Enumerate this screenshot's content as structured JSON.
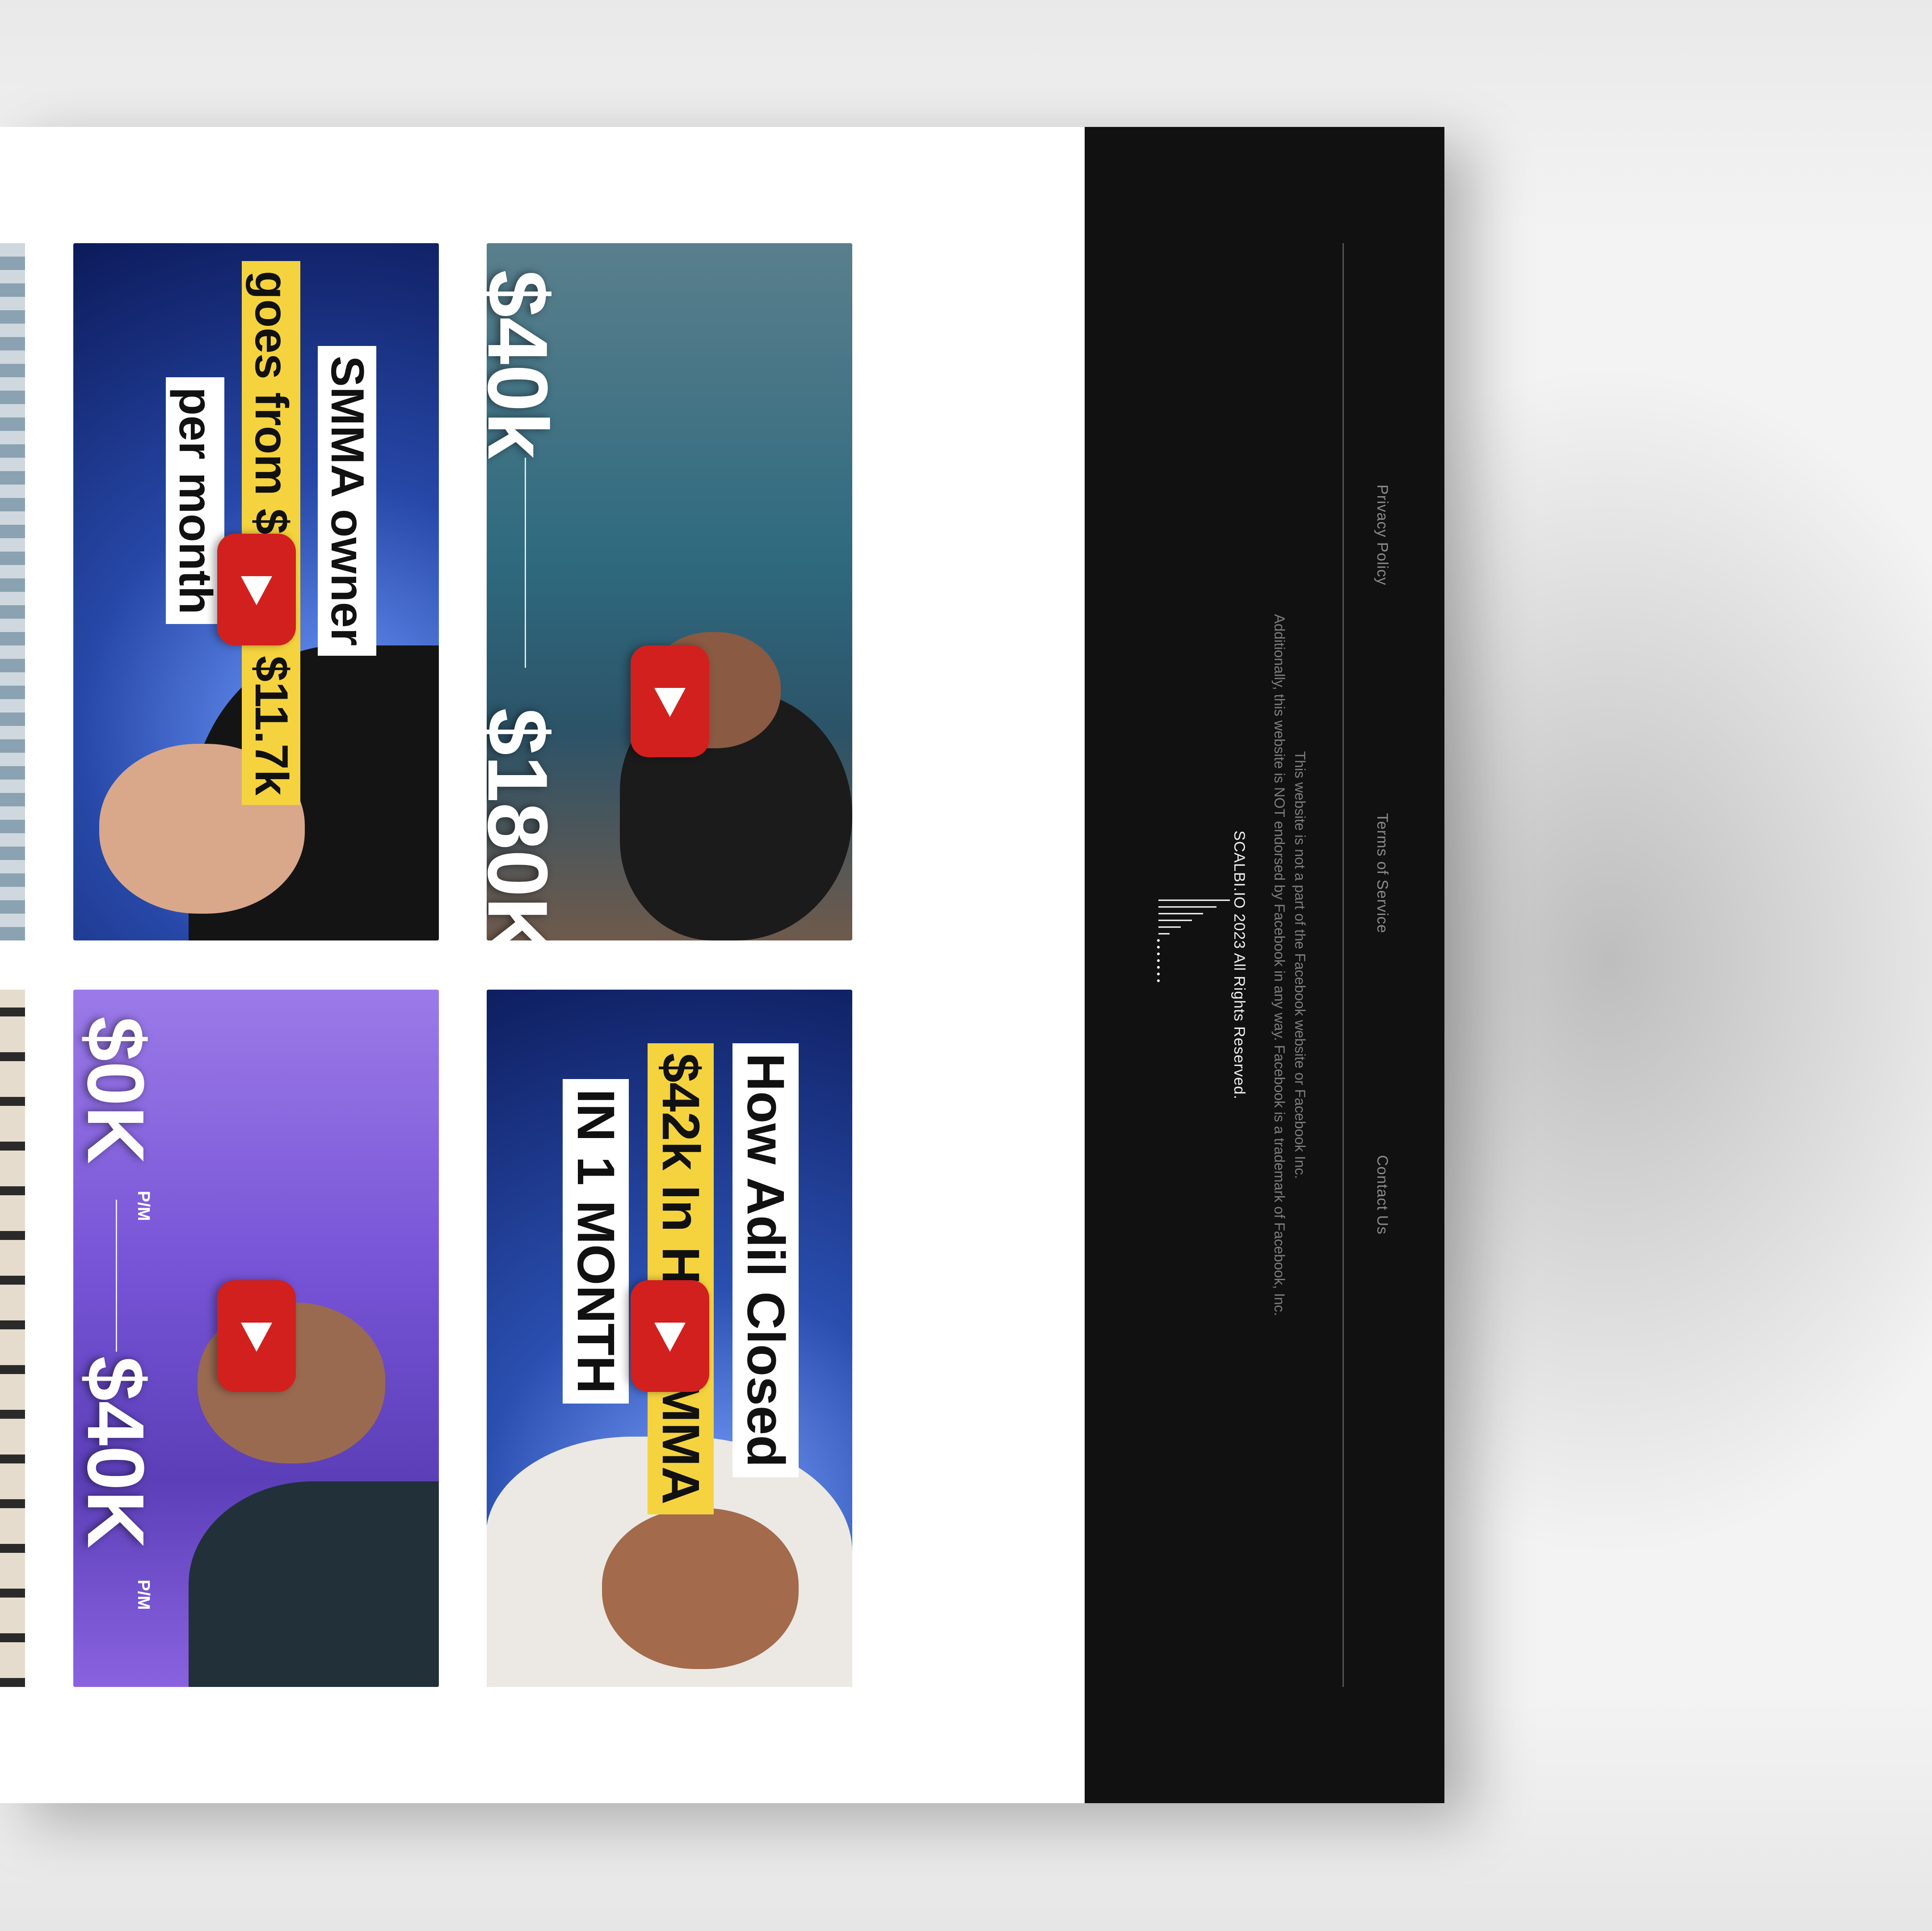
{
  "footer": {
    "links": [
      "Privacy Policy",
      "Terms of Service",
      "Contact Us"
    ],
    "disclaimer_line1": "This website is not a part of the Facebook website or Facebook Inc.",
    "disclaimer_line2": "Additionally, this website is NOT endorsed by Facebook in any way. Facebook is a trademark of Facebook, Inc.",
    "copyright": "SCALBI.IO 2023 All Rights Reserved."
  },
  "videos": [
    {
      "line1": "SMMA owner",
      "line2": "goes from $2k to $11.7k",
      "line3": "per month",
      "highlight": "#f5d33f",
      "background": "#1f3f9a"
    },
    {
      "from": "$40k",
      "to": "$180K",
      "background": "#3f6f83"
    },
    {
      "from": "$0K",
      "from_suffix": "P/M",
      "to": "$40K",
      "to_suffix": "P/M",
      "background": "#7c5bd8"
    },
    {
      "line1": "How Adil Closed",
      "line2": "$42k In His SMMA",
      "line3": "IN 1 MONTH",
      "highlight": "#f5d33f",
      "background": "#203a8f"
    }
  ],
  "play_icon": "play-icon",
  "colors": {
    "footer_bg": "#111111",
    "play_red": "#d2201e"
  }
}
